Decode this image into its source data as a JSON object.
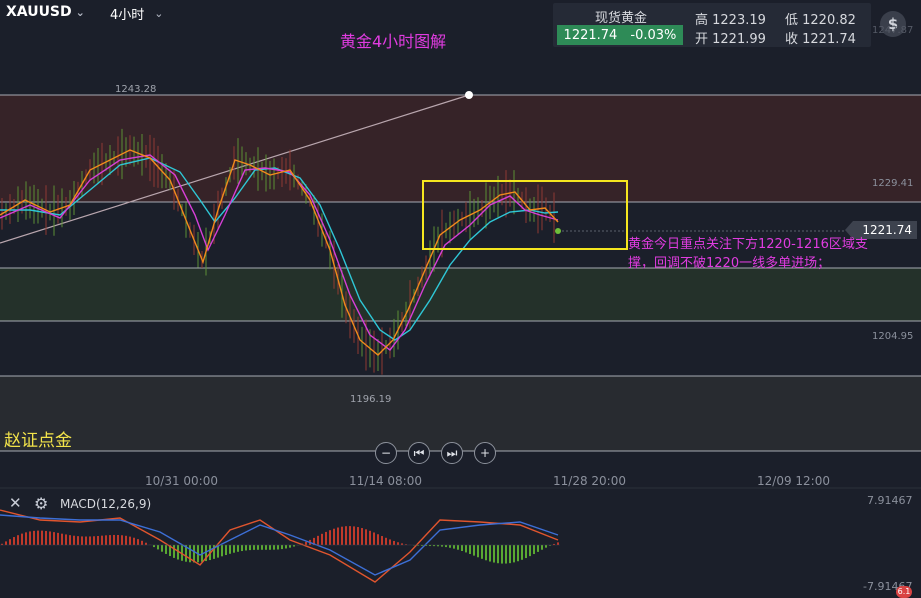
{
  "header": {
    "symbol": "XAUUSD",
    "period": "4小时",
    "chart_title": "黄金4小时图解"
  },
  "quote": {
    "name": "现货黄金",
    "price": "1221.74",
    "change": "-0.03%",
    "high": "高 1223.19",
    "low": "低 1220.82",
    "open": "开 1221.99",
    "close": "收 1221.74"
  },
  "price_axis": {
    "top_partial": "1247.87",
    "level_1229": "1229.41",
    "current": "1221.74",
    "level_1204": "1204.95"
  },
  "annotations": {
    "peak": "1243.28",
    "trough": "1196.19",
    "note": "黄金今日重点关注下方1220-1216区域支撑，回调不破1220一线多单进场；",
    "watermark": "赵证点金"
  },
  "time_axis": [
    "10/31 00:00",
    "11/14 08:00",
    "11/28 20:00",
    "12/09 12:00"
  ],
  "macd": {
    "label": "MACD(12,26,9)",
    "max": "7.91467",
    "min": "-7.91467"
  },
  "nav_buttons": [
    "−",
    "⏮",
    "⏭",
    "+"
  ],
  "colors": {
    "background": "#1b1f2a",
    "ma_fast": "#f08a1c",
    "ma_mid": "#d63fd6",
    "ma_slow": "#2fc7d6",
    "up_candle": "#c0392b",
    "down_candle": "#6fbf3a",
    "highlight_box": "#f5e61f",
    "note_text": "#e03ce0",
    "quote_green": "#2e8b57"
  },
  "icons": [
    "dollar-icon",
    "close-icon",
    "gear-icon",
    "chevron-down-icon"
  ],
  "badge": "6.1"
}
